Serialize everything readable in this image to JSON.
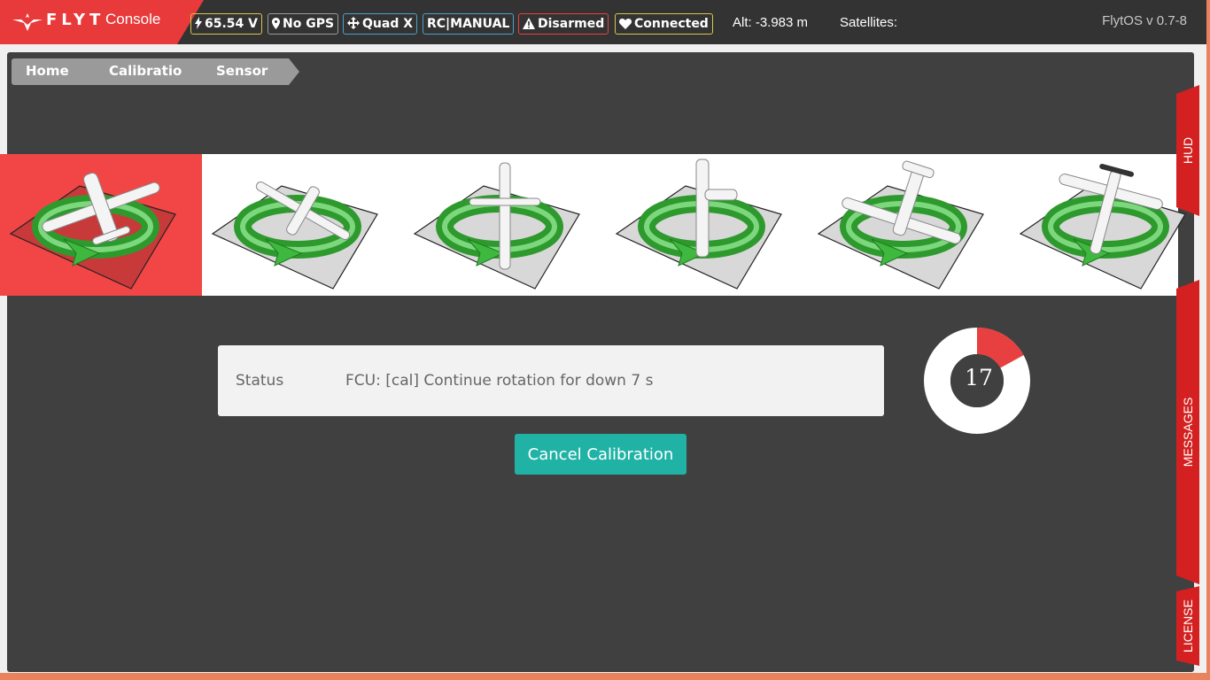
{
  "header": {
    "brand": "FLYT",
    "brand_suffix": "Console",
    "badges": {
      "voltage": "65.54 V",
      "gps": "No GPS",
      "frame": "Quad X",
      "mode": "RC|MANUAL",
      "arm": "Disarmed",
      "link": "Connected"
    },
    "badge_colors": {
      "voltage": "#d6c64a",
      "gps": "#9a9a9a",
      "frame": "#4aa0c8",
      "mode": "#4aa0c8",
      "arm": "#e84040",
      "link": "#d6c64a"
    },
    "altitude": "Alt: -3.983 m",
    "satellites": "Satellites:",
    "version": "FlytOS v 0.7-8"
  },
  "breadcrumb": [
    "Home",
    "Calibratio",
    "Sensor"
  ],
  "calibration_steps": [
    {
      "name": "level",
      "active": true
    },
    {
      "name": "nose-up",
      "active": false
    },
    {
      "name": "nose-down",
      "active": false
    },
    {
      "name": "left-side",
      "active": false
    },
    {
      "name": "right-side",
      "active": false
    },
    {
      "name": "upside-down",
      "active": false
    }
  ],
  "status": {
    "label": "Status",
    "message": "FCU: [cal] Continue rotation for down 7 s"
  },
  "cancel_button": "Cancel Calibration",
  "progress": {
    "value": 17,
    "percent": 17,
    "color": "#e84040"
  },
  "side_tabs": {
    "hud": "HUD",
    "messages": "MESSAGES",
    "license": "LICENSE"
  },
  "colors": {
    "accent": "#e83a3a",
    "teal": "#21b2a6",
    "panel": "#404040"
  }
}
